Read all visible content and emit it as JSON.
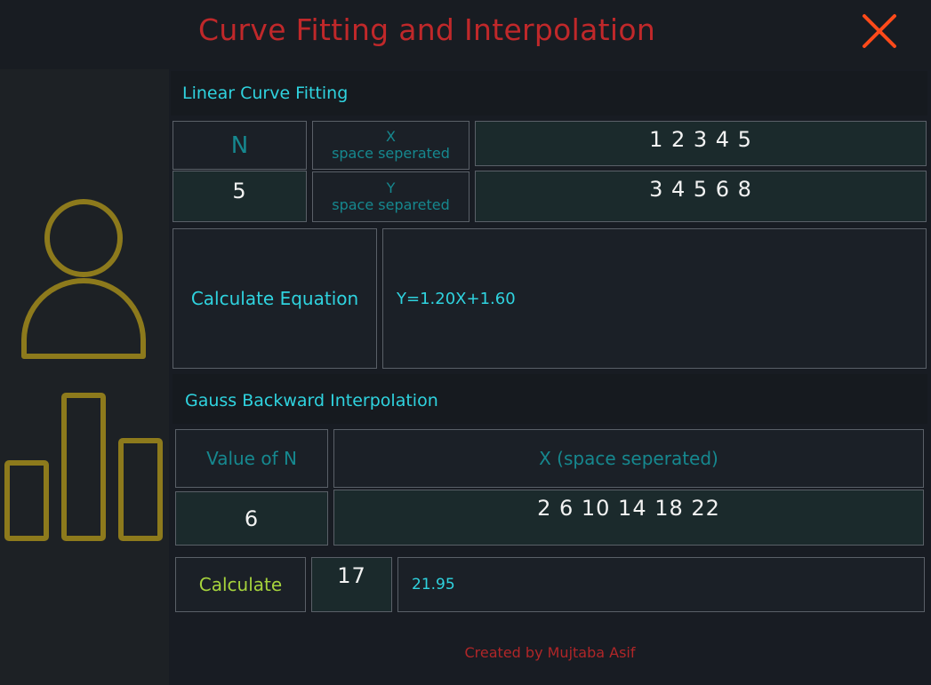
{
  "window": {
    "title": "Curve Fitting and Interpolation"
  },
  "linear": {
    "heading": "Linear Curve Fitting",
    "n_label": "N",
    "n_value": "5",
    "x_label": "X",
    "x_hint": "space seperated",
    "x_value": "1 2 3 4 5",
    "y_label": "Y",
    "y_hint": "space separeted",
    "y_value": "3 4 5 6 8",
    "calculate_label": "Calculate Equation",
    "result": "Y=1.20X+1.60"
  },
  "gauss": {
    "heading": "Gauss Backward Interpolation",
    "n_label": "Value of N",
    "n_value": "6",
    "x_label": "X (space seperated)",
    "x_value": "2 6 10 14 18 22",
    "calculate_label": "Calculate",
    "point_value": "17",
    "result": "21.95"
  },
  "footer": {
    "text": "Created by Mujtaba Asif"
  },
  "colors": {
    "accent_title": "#c0282a",
    "close_icon": "#ff4a1a",
    "section_heading": "#2fd3df",
    "icon_gold": "#8d7a1c",
    "calculate_green": "#a6d33c"
  },
  "icons": [
    "user-icon",
    "bar-chart-icon",
    "close-icon"
  ]
}
